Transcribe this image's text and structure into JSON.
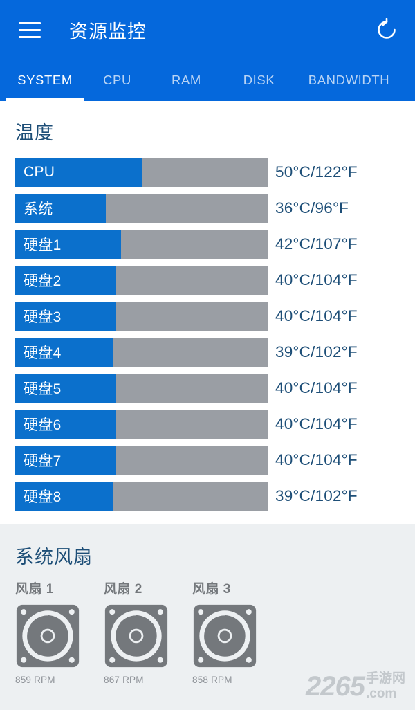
{
  "header": {
    "title": "资源监控",
    "menu_icon": "hamburger-menu-icon",
    "refresh_icon": "refresh-icon"
  },
  "tabs": [
    {
      "label": "SYSTEM",
      "active": true
    },
    {
      "label": "CPU",
      "active": false
    },
    {
      "label": "RAM",
      "active": false
    },
    {
      "label": "DISK",
      "active": false
    },
    {
      "label": "BANDWIDTH",
      "active": false
    }
  ],
  "temperature": {
    "title": "温度",
    "rows": [
      {
        "label": "CPU",
        "value": "50°C/122°F",
        "fill_pct": 50
      },
      {
        "label": "系统",
        "value": "36°C/96°F",
        "fill_pct": 36
      },
      {
        "label": "硬盘1",
        "value": "42°C/107°F",
        "fill_pct": 42
      },
      {
        "label": "硬盘2",
        "value": "40°C/104°F",
        "fill_pct": 40
      },
      {
        "label": "硬盘3",
        "value": "40°C/104°F",
        "fill_pct": 40
      },
      {
        "label": "硬盘4",
        "value": "39°C/102°F",
        "fill_pct": 39
      },
      {
        "label": "硬盘5",
        "value": "40°C/104°F",
        "fill_pct": 40
      },
      {
        "label": "硬盘6",
        "value": "40°C/104°F",
        "fill_pct": 40
      },
      {
        "label": "硬盘7",
        "value": "40°C/104°F",
        "fill_pct": 40
      },
      {
        "label": "硬盘8",
        "value": "39°C/102°F",
        "fill_pct": 39
      }
    ]
  },
  "fans": {
    "title": "系统风扇",
    "items": [
      {
        "name": "风扇 1",
        "rpm": "859 RPM",
        "icon": "fan-icon"
      },
      {
        "name": "风扇 2",
        "rpm": "867 RPM",
        "icon": "fan-icon"
      },
      {
        "name": "风扇 3",
        "rpm": "858 RPM",
        "icon": "fan-icon"
      }
    ]
  },
  "watermark": {
    "main": "2265",
    "cn": "手游网",
    "com": ".com"
  },
  "colors": {
    "header_blue": "#0568DC",
    "bar_fill_blue": "#0B70CC",
    "bar_track_gray": "#9A9EA4",
    "text_navy": "#1D4E77",
    "fan_section_bg": "#EDF0F2",
    "fan_gray": "#74787C"
  }
}
